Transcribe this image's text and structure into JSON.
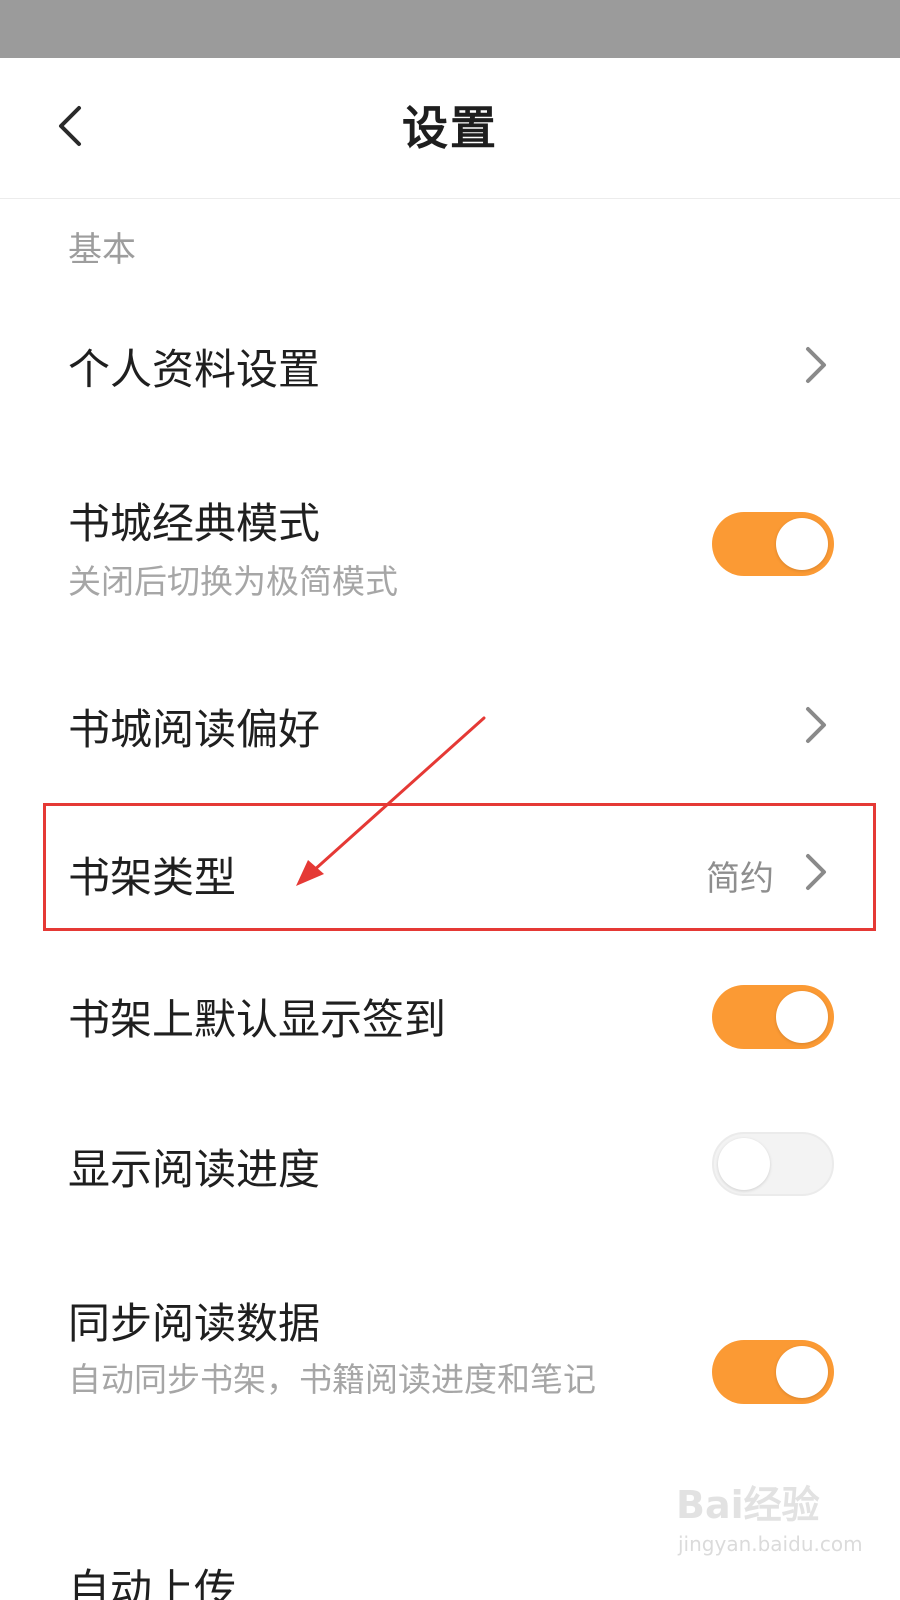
{
  "nav": {
    "title": "设置",
    "back_icon": "chevron-left-icon"
  },
  "section": {
    "label": "基本"
  },
  "rows": [
    {
      "title": "个人资料设置",
      "control": "chevron"
    },
    {
      "title": "书城经典模式",
      "subtitle": "关闭后切换为极简模式",
      "control": "toggle",
      "toggle_on": true
    },
    {
      "title": "书城阅读偏好",
      "control": "chevron"
    },
    {
      "title": "书架类型",
      "value": "简约",
      "control": "chevron"
    },
    {
      "title": "书架上默认显示签到",
      "control": "toggle",
      "toggle_on": true
    },
    {
      "title": "显示阅读进度",
      "control": "toggle",
      "toggle_on": false
    },
    {
      "title": "同步阅读数据",
      "subtitle": "自动同步书架，书籍阅读进度和笔记",
      "control": "toggle",
      "toggle_on": true
    },
    {
      "title": "自动上传"
    }
  ],
  "colors": {
    "accent": "#fb9a34",
    "annotation": "#e53935",
    "status_bar": "#9b9b9b"
  },
  "watermark": {
    "brand": "Bai经验",
    "url": "jingyan.baidu.com"
  }
}
